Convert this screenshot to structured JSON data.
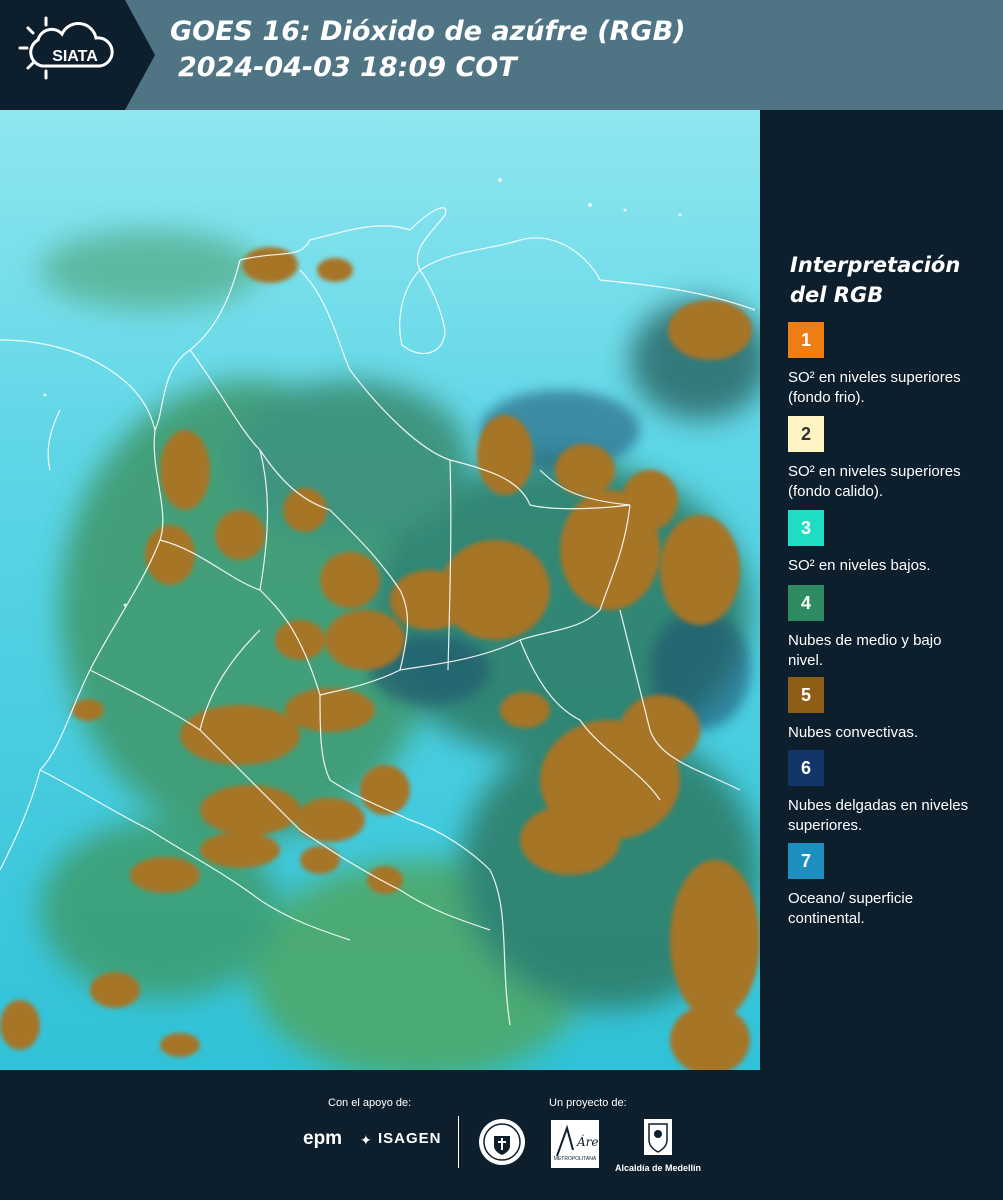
{
  "header": {
    "logo_text": "SIATA",
    "title_line1": "GOES 16: Dióxido de azúfre (RGB)",
    "title_line2": "2024-04-03 18:09 COT"
  },
  "legend": {
    "title": "Interpretación del RGB",
    "items": [
      {
        "number": "1",
        "color": "#f07d14",
        "text_color": "#ffffff",
        "label": "SO² en niveles superiores (fondo frio)."
      },
      {
        "number": "2",
        "color": "#fdf4c3",
        "text_color": "#333333",
        "label": "SO² en niveles superiores (fondo calido)."
      },
      {
        "number": "3",
        "color": "#1fdcc4",
        "text_color": "#ffffff",
        "label": "SO² en niveles bajos."
      },
      {
        "number": "4",
        "color": "#2e8b62",
        "text_color": "#ffffff",
        "label": "Nubes de medio y bajo nivel."
      },
      {
        "number": "5",
        "color": "#8e5e16",
        "text_color": "#ffffff",
        "label": "Nubes convectivas."
      },
      {
        "number": "6",
        "color": "#12356a",
        "text_color": "#ffffff",
        "label": "Nubes delgadas en niveles superiores."
      },
      {
        "number": "7",
        "color": "#1c8fbf",
        "text_color": "#ffffff",
        "label": "Oceano/ superficie continental."
      }
    ]
  },
  "footer": {
    "support_label": "Con el apoyo de:",
    "project_label": "Un proyecto de:",
    "sponsor_1": "epm",
    "sponsor_2": "ISAGEN",
    "partner_area": "Área",
    "partner_area_sub": "METROPOLITANA",
    "partner_alcaldia": "Alcaldía de Medellín"
  },
  "colors": {
    "header_bg": "#4f7585",
    "panel_bg": "#0d1f2d",
    "map_background": "#38c8dc",
    "convective_cloud": "#a67526"
  }
}
